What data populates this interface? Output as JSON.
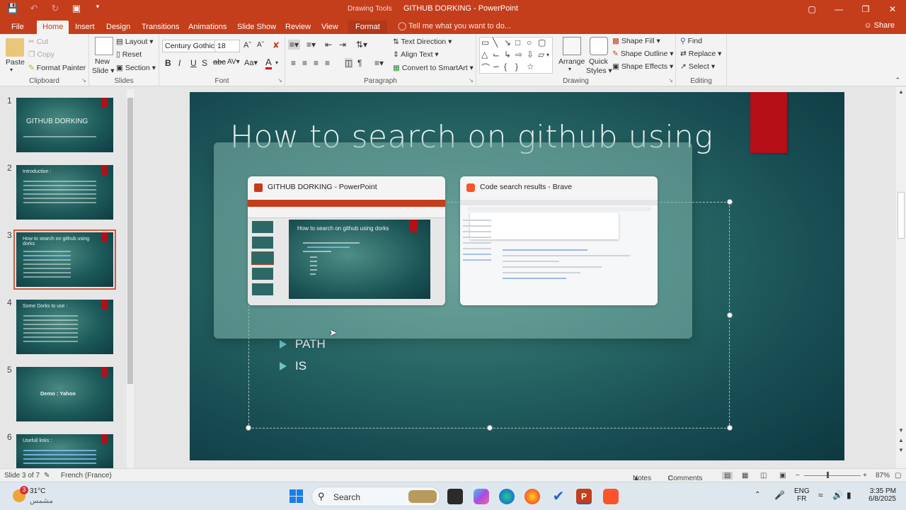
{
  "titlebar": {
    "drawing_tools": "Drawing Tools",
    "title": "GITHUB DORKING - PowerPoint"
  },
  "tabs": [
    "File",
    "Home",
    "Insert",
    "Design",
    "Transitions",
    "Animations",
    "Slide Show",
    "Review",
    "View",
    "Format"
  ],
  "tellme": "Tell me what you want to do...",
  "share": "Share",
  "clipboard": {
    "paste": "Paste",
    "cut": "Cut",
    "copy": "Copy",
    "format_painter": "Format Painter",
    "label": "Clipboard"
  },
  "slides_group": {
    "new_slide": "New",
    "new_slide2": "Slide",
    "layout": "Layout",
    "reset": "Reset",
    "section": "Section",
    "label": "Slides"
  },
  "font_group": {
    "font_name": "Century Gothic",
    "font_size": "18",
    "label": "Font"
  },
  "paragraph_group": {
    "text_direction": "Text Direction",
    "align_text": "Align Text",
    "convert_smartart": "Convert to SmartArt",
    "label": "Paragraph"
  },
  "drawing_group": {
    "arrange": "Arrange",
    "quick": "Quick",
    "styles": "Styles",
    "shape_fill": "Shape Fill",
    "shape_outline": "Shape Outline",
    "shape_effects": "Shape Effects",
    "label": "Drawing"
  },
  "editing_group": {
    "find": "Find",
    "replace": "Replace",
    "select": "Select",
    "label": "Editing"
  },
  "thumbnails": [
    {
      "num": "1",
      "title": "GITHUB DORKING"
    },
    {
      "num": "2",
      "title": "Introduction :"
    },
    {
      "num": "3",
      "title": "How to search on github using dorks"
    },
    {
      "num": "4",
      "title": "Some Dorks to use :"
    },
    {
      "num": "5",
      "title": "Demo : Yahoo"
    },
    {
      "num": "6",
      "title": "Usefull links :"
    }
  ],
  "slide": {
    "title": "How to search on github using",
    "bullets": [
      "PATH",
      "IS"
    ]
  },
  "switcher": {
    "windows": [
      {
        "title": "GITHUB DORKING - PowerPoint",
        "preview_title": "How to search on github using dorks"
      },
      {
        "title": "Code search results - Brave"
      }
    ]
  },
  "statusbar": {
    "slide_count": "Slide 3 of 7",
    "language": "French (France)",
    "notes": "Notes",
    "comments": "Comments",
    "zoom": "87%"
  },
  "taskbar": {
    "weather_temp": "31°C",
    "weather_desc": "مشمس",
    "weather_badge": "3",
    "search": "Search",
    "lang1": "ENG",
    "lang2": "FR",
    "time": "3:35 PM",
    "date": "6/8/2025"
  }
}
